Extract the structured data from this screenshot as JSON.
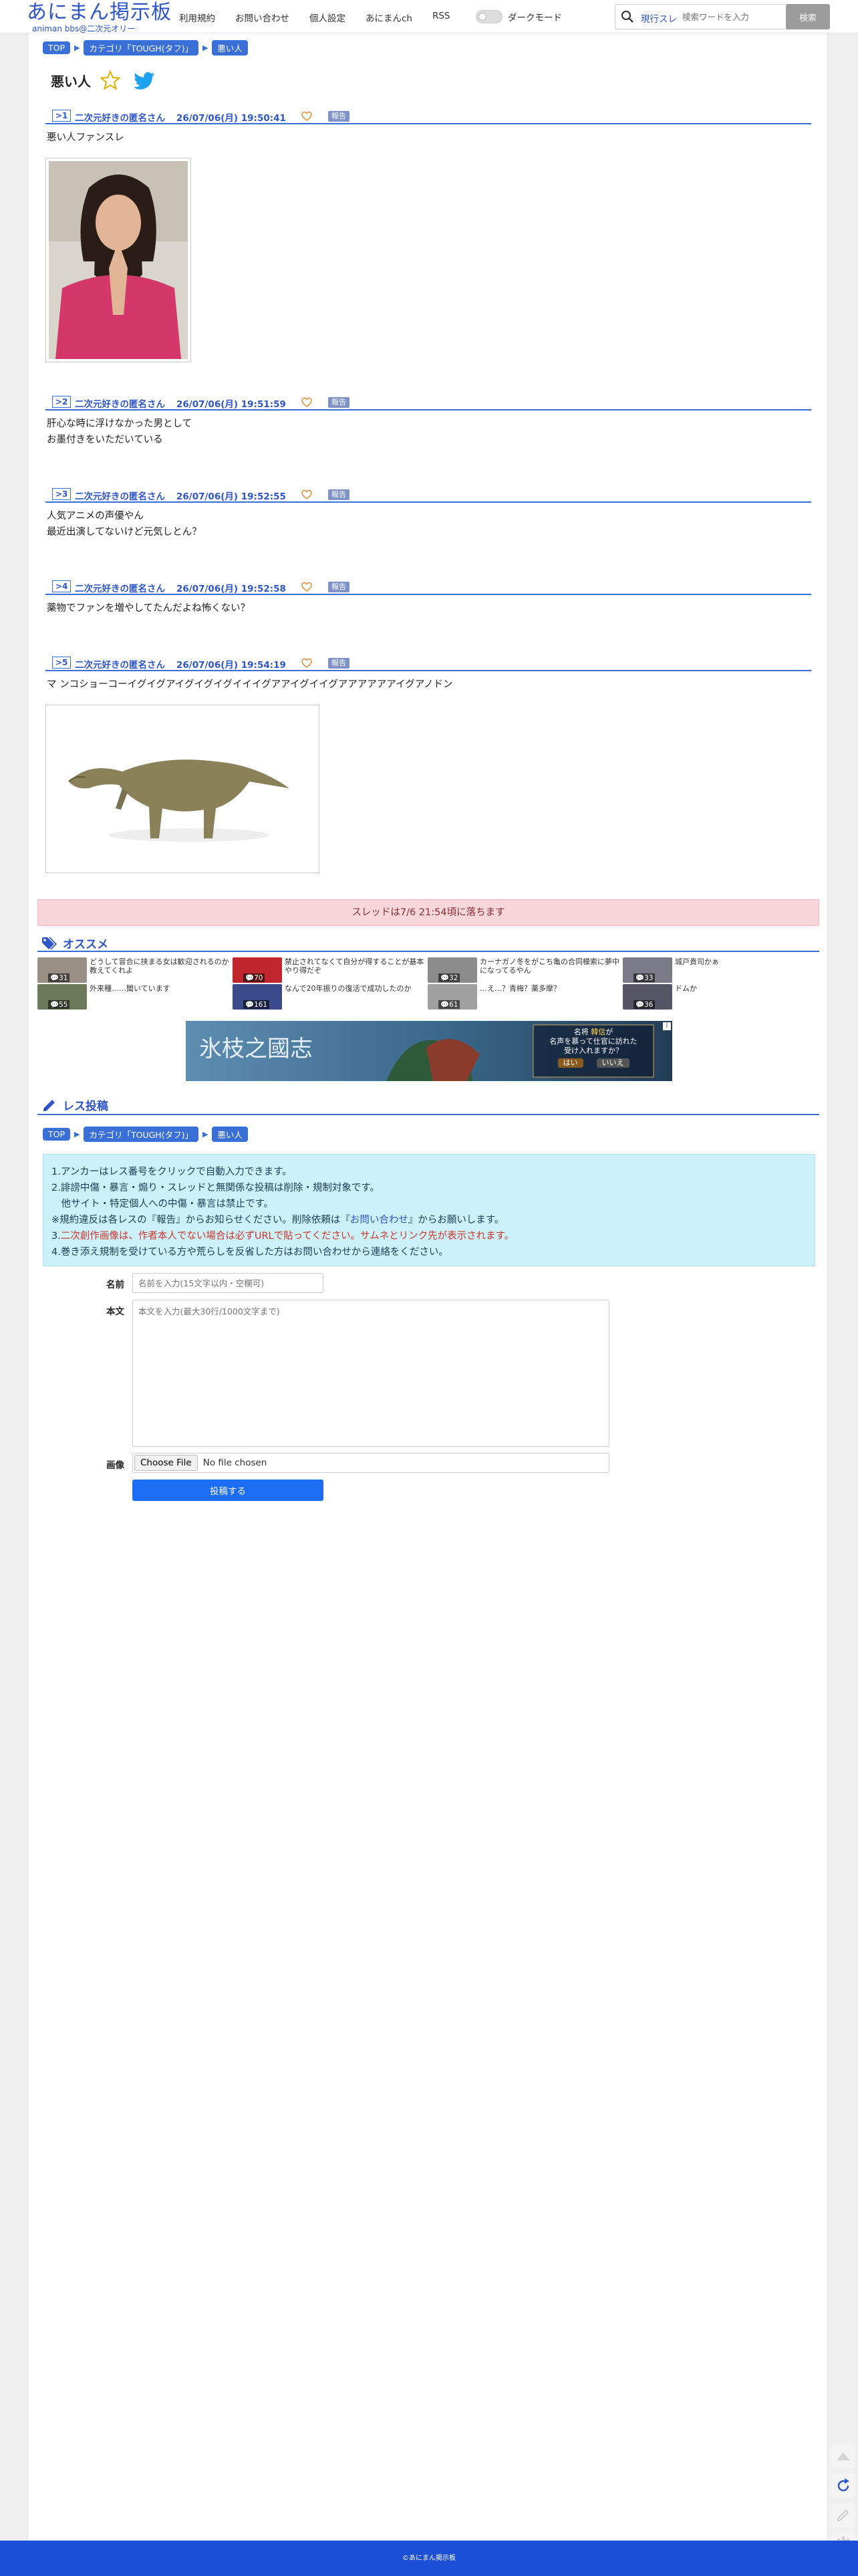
{
  "header": {
    "logo": "あにまん掲示板",
    "logo_sub": "animan bbs@二次元オリー",
    "nav": [
      "利用規約",
      "お問い合わせ",
      "個人設定",
      "あにまんch",
      "RSS"
    ],
    "dark_mode_label": "ダークモード",
    "search_mode": "現行スレ",
    "search_placeholder": "検索ワードを入力",
    "search_button": "検索"
  },
  "breadcrumb": [
    "TOP",
    "カテゴリ「TOUGH(タフ)」",
    "悪い人"
  ],
  "thread": {
    "title": "悪い人"
  },
  "posts": [
    {
      "no": "1",
      "name": "二次元好きの匿名さん",
      "date": "26/07/06(月) 19:50:41",
      "report": "報告",
      "lines": [
        "悪い人ファンスレ"
      ]
    },
    {
      "no": "2",
      "name": "二次元好きの匿名さん",
      "date": "26/07/06(月) 19:51:59",
      "report": "報告",
      "lines": [
        "肝心な時に浮けなかった男として",
        "お墨付きをいただいている"
      ]
    },
    {
      "no": "3",
      "name": "二次元好きの匿名さん",
      "date": "26/07/06(月) 19:52:55",
      "report": "報告",
      "lines": [
        "人気アニメの声優やん",
        "最近出演してないけど元気しとん？"
      ]
    },
    {
      "no": "4",
      "name": "二次元好きの匿名さん",
      "date": "26/07/06(月) 19:52:58",
      "report": "報告",
      "lines": [
        "薬物でファンを増やしてたんだよね怖くない？"
      ]
    },
    {
      "no": "5",
      "name": "二次元好きの匿名さん",
      "date": "26/07/06(月) 19:54:19",
      "report": "報告",
      "lines": [
        "マ ンコショーコーイグイグアイグイグイグイイイグアアイグイイグアアアアアアイグアノドン"
      ]
    }
  ],
  "closed_notice": "スレッドは7/6 21:54頃に落ちます",
  "recommend": {
    "heading": "オススメ",
    "items": [
      {
        "title": "どうして冒合に挟まる女は歓迎されるのか教えてくれよ",
        "count": "31"
      },
      {
        "title": "禁止されてなくて自分が得することが基本やり得だぞ",
        "count": "70"
      },
      {
        "title": "カーナガノ冬をがこち亀の合同模索に夢中になってるやん",
        "count": "32"
      },
      {
        "title": "城戸貴司かぁ",
        "count": "33"
      },
      {
        "title": "外来種……聞いています",
        "count": "55"
      },
      {
        "title": "なんで20年振りの復活で成功したのか",
        "count": "161"
      },
      {
        "title": "…え…？青梅？薬多摩？",
        "count": "61"
      },
      {
        "title": "ドムか",
        "count": "36"
      }
    ]
  },
  "ad": {
    "line1": "名将",
    "highlight": "韓信",
    "line2": "が",
    "line3": "名声を慕って仕官に訪れた",
    "line4": "受け入れますか？",
    "yes": "はい",
    "no": "いいえ",
    "logo": "氷枝之國志"
  },
  "reply": {
    "heading": "レス投稿",
    "notice": {
      "l1": "1.アンカーはレス番号をクリックで自動入力できます。",
      "l2": "2.誹謗中傷・暴言・煽り・スレッドと無関係な投稿は削除・規制対象です。",
      "l3": "　他サイト・特定個人への中傷・暴言は禁止です。",
      "l4a": "※規約違反は各レスの『報告』からお知らせください。削除依頼は『",
      "l4link": "お問い合わせ",
      "l4b": "』からお願いします。",
      "l5a": "3.",
      "l5red": "二次創作画像は、作者本人でない場合は必ずURLで貼ってください。サムネとリンク先が表示されます。",
      "l6": "4.巻き添え規制を受けている方や荒らしを反省した方はお問い合わせから連絡をください。"
    },
    "name_label": "名前",
    "name_placeholder": "名前を入力(15文字以内・空欄可)",
    "body_label": "本文",
    "body_placeholder": "本文を入力(最大30行/1000文字まで)",
    "image_label": "画像",
    "file_button": "Choose File",
    "file_status": "No file chosen",
    "submit": "投稿する"
  },
  "footer": "©あにまん掲示板",
  "colors": {
    "accent": "#3a6fd8",
    "brand": "#2f56c9",
    "footer": "#1b4fd8"
  }
}
